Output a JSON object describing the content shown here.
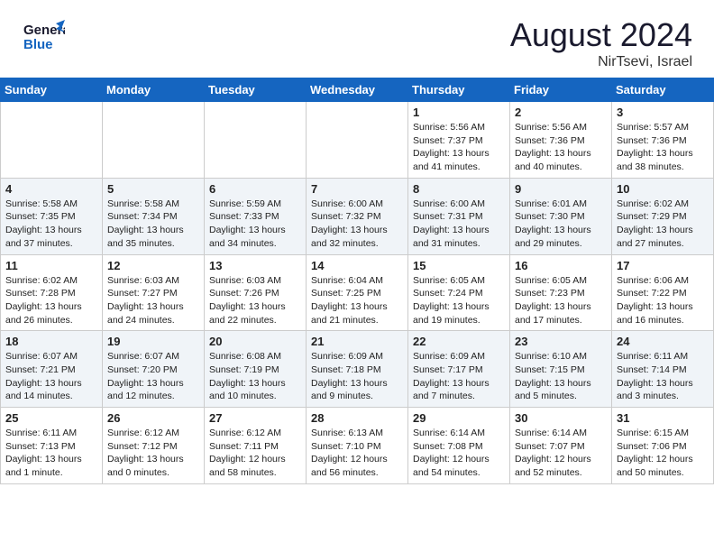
{
  "header": {
    "logo_line1": "General",
    "logo_line2": "Blue",
    "month_year": "August 2024",
    "location": "NirTsevi, Israel"
  },
  "weekdays": [
    "Sunday",
    "Monday",
    "Tuesday",
    "Wednesday",
    "Thursday",
    "Friday",
    "Saturday"
  ],
  "weeks": [
    [
      {
        "day": "",
        "info": ""
      },
      {
        "day": "",
        "info": ""
      },
      {
        "day": "",
        "info": ""
      },
      {
        "day": "",
        "info": ""
      },
      {
        "day": "1",
        "info": "Sunrise: 5:56 AM\nSunset: 7:37 PM\nDaylight: 13 hours\nand 41 minutes."
      },
      {
        "day": "2",
        "info": "Sunrise: 5:56 AM\nSunset: 7:36 PM\nDaylight: 13 hours\nand 40 minutes."
      },
      {
        "day": "3",
        "info": "Sunrise: 5:57 AM\nSunset: 7:36 PM\nDaylight: 13 hours\nand 38 minutes."
      }
    ],
    [
      {
        "day": "4",
        "info": "Sunrise: 5:58 AM\nSunset: 7:35 PM\nDaylight: 13 hours\nand 37 minutes."
      },
      {
        "day": "5",
        "info": "Sunrise: 5:58 AM\nSunset: 7:34 PM\nDaylight: 13 hours\nand 35 minutes."
      },
      {
        "day": "6",
        "info": "Sunrise: 5:59 AM\nSunset: 7:33 PM\nDaylight: 13 hours\nand 34 minutes."
      },
      {
        "day": "7",
        "info": "Sunrise: 6:00 AM\nSunset: 7:32 PM\nDaylight: 13 hours\nand 32 minutes."
      },
      {
        "day": "8",
        "info": "Sunrise: 6:00 AM\nSunset: 7:31 PM\nDaylight: 13 hours\nand 31 minutes."
      },
      {
        "day": "9",
        "info": "Sunrise: 6:01 AM\nSunset: 7:30 PM\nDaylight: 13 hours\nand 29 minutes."
      },
      {
        "day": "10",
        "info": "Sunrise: 6:02 AM\nSunset: 7:29 PM\nDaylight: 13 hours\nand 27 minutes."
      }
    ],
    [
      {
        "day": "11",
        "info": "Sunrise: 6:02 AM\nSunset: 7:28 PM\nDaylight: 13 hours\nand 26 minutes."
      },
      {
        "day": "12",
        "info": "Sunrise: 6:03 AM\nSunset: 7:27 PM\nDaylight: 13 hours\nand 24 minutes."
      },
      {
        "day": "13",
        "info": "Sunrise: 6:03 AM\nSunset: 7:26 PM\nDaylight: 13 hours\nand 22 minutes."
      },
      {
        "day": "14",
        "info": "Sunrise: 6:04 AM\nSunset: 7:25 PM\nDaylight: 13 hours\nand 21 minutes."
      },
      {
        "day": "15",
        "info": "Sunrise: 6:05 AM\nSunset: 7:24 PM\nDaylight: 13 hours\nand 19 minutes."
      },
      {
        "day": "16",
        "info": "Sunrise: 6:05 AM\nSunset: 7:23 PM\nDaylight: 13 hours\nand 17 minutes."
      },
      {
        "day": "17",
        "info": "Sunrise: 6:06 AM\nSunset: 7:22 PM\nDaylight: 13 hours\nand 16 minutes."
      }
    ],
    [
      {
        "day": "18",
        "info": "Sunrise: 6:07 AM\nSunset: 7:21 PM\nDaylight: 13 hours\nand 14 minutes."
      },
      {
        "day": "19",
        "info": "Sunrise: 6:07 AM\nSunset: 7:20 PM\nDaylight: 13 hours\nand 12 minutes."
      },
      {
        "day": "20",
        "info": "Sunrise: 6:08 AM\nSunset: 7:19 PM\nDaylight: 13 hours\nand 10 minutes."
      },
      {
        "day": "21",
        "info": "Sunrise: 6:09 AM\nSunset: 7:18 PM\nDaylight: 13 hours\nand 9 minutes."
      },
      {
        "day": "22",
        "info": "Sunrise: 6:09 AM\nSunset: 7:17 PM\nDaylight: 13 hours\nand 7 minutes."
      },
      {
        "day": "23",
        "info": "Sunrise: 6:10 AM\nSunset: 7:15 PM\nDaylight: 13 hours\nand 5 minutes."
      },
      {
        "day": "24",
        "info": "Sunrise: 6:11 AM\nSunset: 7:14 PM\nDaylight: 13 hours\nand 3 minutes."
      }
    ],
    [
      {
        "day": "25",
        "info": "Sunrise: 6:11 AM\nSunset: 7:13 PM\nDaylight: 13 hours\nand 1 minute."
      },
      {
        "day": "26",
        "info": "Sunrise: 6:12 AM\nSunset: 7:12 PM\nDaylight: 13 hours\nand 0 minutes."
      },
      {
        "day": "27",
        "info": "Sunrise: 6:12 AM\nSunset: 7:11 PM\nDaylight: 12 hours\nand 58 minutes."
      },
      {
        "day": "28",
        "info": "Sunrise: 6:13 AM\nSunset: 7:10 PM\nDaylight: 12 hours\nand 56 minutes."
      },
      {
        "day": "29",
        "info": "Sunrise: 6:14 AM\nSunset: 7:08 PM\nDaylight: 12 hours\nand 54 minutes."
      },
      {
        "day": "30",
        "info": "Sunrise: 6:14 AM\nSunset: 7:07 PM\nDaylight: 12 hours\nand 52 minutes."
      },
      {
        "day": "31",
        "info": "Sunrise: 6:15 AM\nSunset: 7:06 PM\nDaylight: 12 hours\nand 50 minutes."
      }
    ]
  ]
}
